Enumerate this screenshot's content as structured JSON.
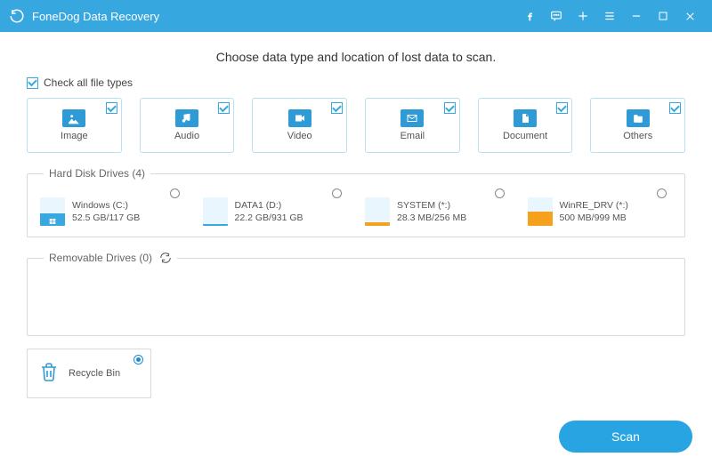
{
  "app": {
    "title": "FoneDog Data Recovery"
  },
  "headline": "Choose data type and location of lost data to scan.",
  "check_all_label": "Check all file types",
  "types": [
    {
      "key": "image",
      "label": "Image",
      "checked": true
    },
    {
      "key": "audio",
      "label": "Audio",
      "checked": true
    },
    {
      "key": "video",
      "label": "Video",
      "checked": true
    },
    {
      "key": "email",
      "label": "Email",
      "checked": true
    },
    {
      "key": "document",
      "label": "Document",
      "checked": true
    },
    {
      "key": "others",
      "label": "Others",
      "checked": true
    }
  ],
  "hdd": {
    "legend": "Hard Disk Drives (4)",
    "drives": [
      {
        "name": "Windows (C:)",
        "usage": "52.5 GB/117 GB",
        "fill_pct": 45,
        "color": "blue",
        "os": true
      },
      {
        "name": "DATA1 (D:)",
        "usage": "22.2 GB/931 GB",
        "fill_pct": 6,
        "color": "blue",
        "os": false
      },
      {
        "name": "SYSTEM (*:)",
        "usage": "28.3 MB/256 MB",
        "fill_pct": 12,
        "color": "orange",
        "os": false
      },
      {
        "name": "WinRE_DRV (*:)",
        "usage": "500 MB/999 MB",
        "fill_pct": 50,
        "color": "orange",
        "os": false
      }
    ]
  },
  "removable": {
    "legend": "Removable Drives (0)"
  },
  "recycle": {
    "label": "Recycle Bin",
    "selected": true
  },
  "scan_label": "Scan"
}
